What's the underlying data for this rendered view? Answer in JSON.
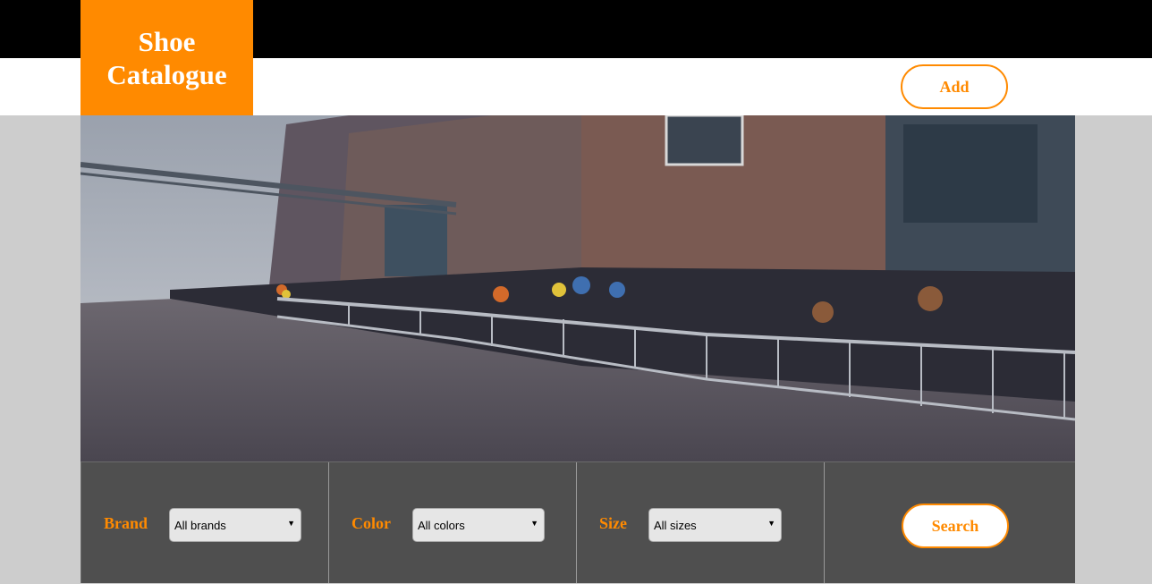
{
  "header": {
    "logo_line1": "Shoe",
    "logo_line2": "Catalogue",
    "add_label": "Add"
  },
  "filters": {
    "brand": {
      "label": "Brand",
      "selected": "All brands"
    },
    "color": {
      "label": "Color",
      "selected": "All colors"
    },
    "size": {
      "label": "Size",
      "selected": "All sizes"
    },
    "search_label": "Search"
  },
  "icons": {
    "dropdown": "triangle-down-icon"
  },
  "colors": {
    "accent": "#ff8a00",
    "panel": "#4f4f4f",
    "topbar": "#000000"
  }
}
